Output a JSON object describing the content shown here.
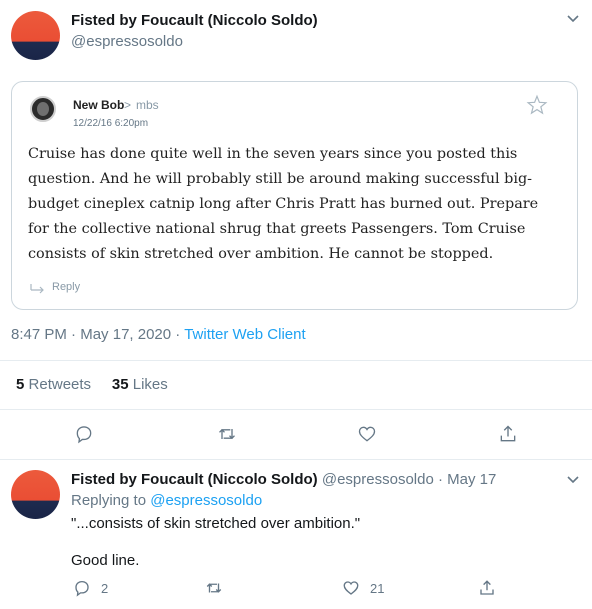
{
  "tweet": {
    "author_name": "Fisted by Foucault (Niccolo Soldo)",
    "author_handle": "@espressosoldo",
    "time": "8:47 PM",
    "dot1": "·",
    "date": "May 17, 2020",
    "dot2": "·",
    "client": "Twitter Web Client",
    "retweets_count": "5",
    "retweets_label": "Retweets",
    "likes_count": "35",
    "likes_label": "Likes"
  },
  "quote": {
    "author": "New Bob",
    "separator": ">",
    "handle": "mbs",
    "timestamp": "12/22/16 6:20pm",
    "text": "Cruise has done quite well in the seven years since you posted this question. And he will probably still be around making successful big-budget cineplex catnip long after Chris Pratt has burned out. Prepare for the collective national shrug that greets Passengers. Tom Cruise consists of skin stretched over ambition. He cannot be stopped.",
    "reply_label": "Reply"
  },
  "reply": {
    "author_name": "Fisted by Foucault (Niccolo Soldo)",
    "author_handle": "@espressosoldo",
    "dot": "·",
    "date": "May 17",
    "replying_prefix": "Replying to",
    "replying_to": "@espressosoldo",
    "body_line1": "\"...consists of skin stretched over ambition.\"",
    "body_line2": "Good line.",
    "reply_count": "2",
    "like_count": "21"
  },
  "icons": {
    "chevron": "chevron-down-icon",
    "star": "star-icon",
    "reply": "reply-icon",
    "retweet": "retweet-icon",
    "like": "heart-icon",
    "share": "share-icon"
  },
  "colors": {
    "accent": "#1da1f2",
    "secondary_text": "#657786",
    "border": "#e6ecf0"
  }
}
